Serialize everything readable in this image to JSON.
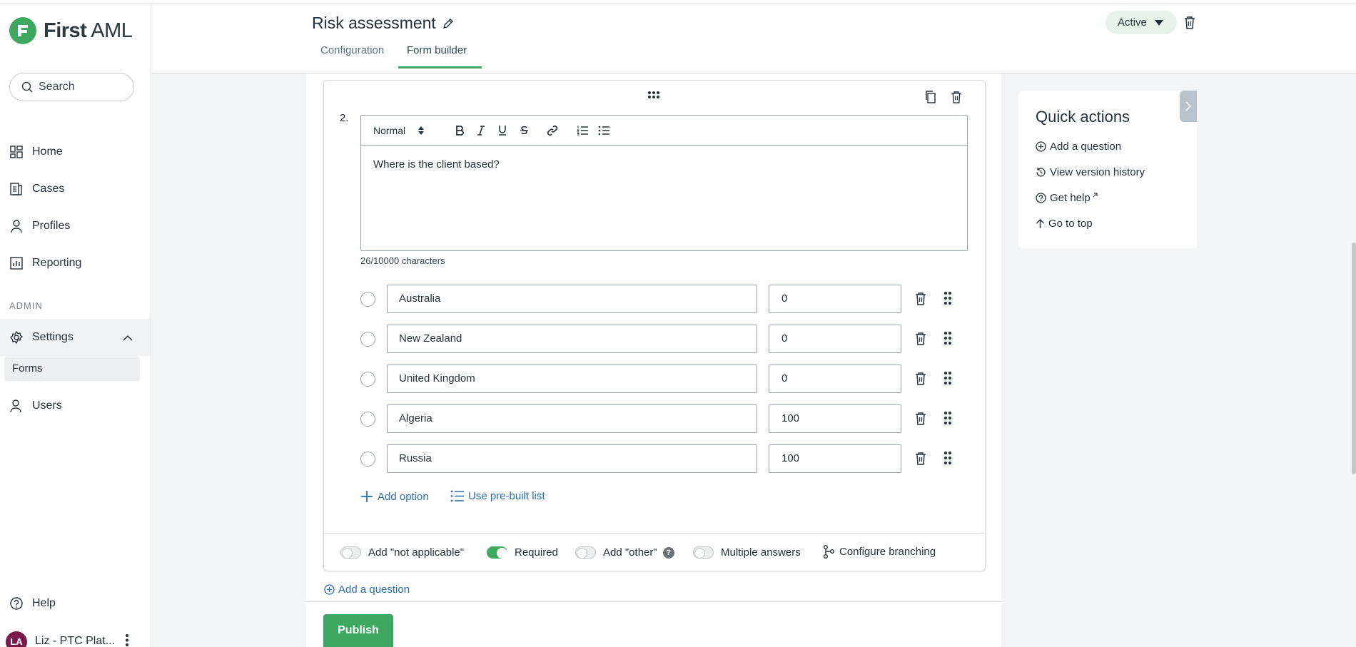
{
  "brand": {
    "name_bold": "First",
    "name_rest": " AML",
    "accent": "#3ea760"
  },
  "sidebar": {
    "search_label": "Search",
    "items": [
      {
        "label": "Home",
        "icon": "dashboard-icon"
      },
      {
        "label": "Cases",
        "icon": "cases-icon"
      },
      {
        "label": "Profiles",
        "icon": "person-icon"
      },
      {
        "label": "Reporting",
        "icon": "chart-icon"
      }
    ],
    "admin_label": "ADMIN",
    "settings_label": "Settings",
    "settings_sub": "Forms",
    "users_label": "Users",
    "help_label": "Help",
    "user": {
      "initials": "LA",
      "name": "Liz - PTC Plat..."
    }
  },
  "header": {
    "title": "Risk assessment",
    "tabs": [
      "Configuration",
      "Form builder"
    ],
    "active_tab": "Form builder",
    "status": "Active"
  },
  "question": {
    "number": "2.",
    "format": "Normal",
    "toolbar_icons": [
      "bold-icon",
      "italic-icon",
      "underline-icon",
      "strikethrough-icon",
      "link-icon",
      "ordered-list-icon",
      "bullet-list-icon"
    ],
    "text": "Where is the client based?",
    "char_count": "26/10000 characters",
    "options": [
      {
        "label": "Australia",
        "score": "0"
      },
      {
        "label": "New Zealand",
        "score": "0"
      },
      {
        "label": "United Kingdom",
        "score": "0"
      },
      {
        "label": "Algeria",
        "score": "100"
      },
      {
        "label": "Russia",
        "score": "100"
      }
    ],
    "add_option_label": "Add option",
    "prebuilt_label": "Use pre-built list",
    "toggles": [
      {
        "label": "Add \"not applicable\"",
        "on": false
      },
      {
        "label": "Required",
        "on": true
      },
      {
        "label": "Add \"other\"",
        "on": false
      },
      {
        "label": "Multiple answers",
        "on": false
      }
    ],
    "branching_label": "Configure branching"
  },
  "add_question_label": "Add a question",
  "publish_label": "Publish",
  "quick_actions": {
    "title": "Quick actions",
    "items": [
      "Add a question",
      "View version history",
      "Get help",
      "Go to top"
    ]
  }
}
